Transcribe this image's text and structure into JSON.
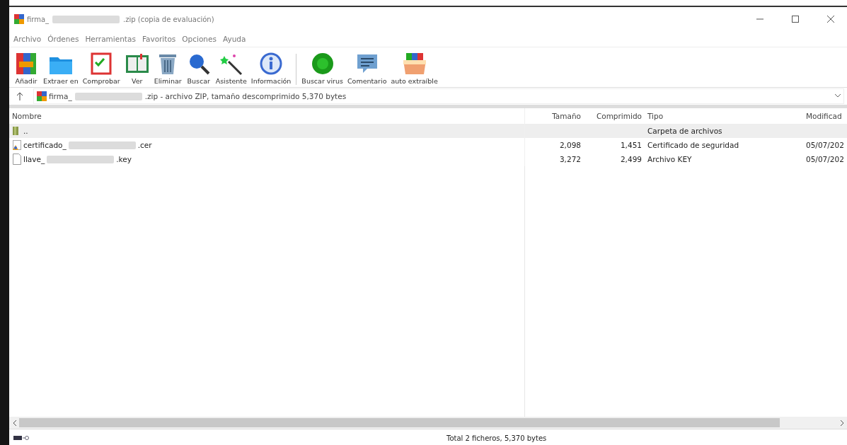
{
  "window": {
    "title_start": "firma_",
    "title_end": ".zip (copia de evaluación)"
  },
  "menu": [
    "Archivo",
    "Órdenes",
    "Herramientas",
    "Favoritos",
    "Opciones",
    "Ayuda"
  ],
  "toolbar": [
    {
      "label": "Añadir",
      "kind": "add"
    },
    {
      "label": "Extraer en",
      "kind": "extract"
    },
    {
      "label": "Comprobar",
      "kind": "test"
    },
    {
      "label": "Ver",
      "kind": "view"
    },
    {
      "label": "Eliminar",
      "kind": "delete"
    },
    {
      "label": "Buscar",
      "kind": "find"
    },
    {
      "label": "Asistente",
      "kind": "wizard"
    },
    {
      "label": "Información",
      "kind": "info"
    },
    {
      "label": "Buscar virus",
      "kind": "virus"
    },
    {
      "label": "Comentario",
      "kind": "comment"
    },
    {
      "label": "auto extraíble",
      "kind": "sfx"
    }
  ],
  "address": {
    "start": "firma_",
    "end": ".zip - archivo ZIP, tamaño descomprimido 5,370 bytes"
  },
  "table": {
    "columns": [
      "Nombre",
      "Tamaño",
      "Comprimido",
      "Tipo",
      "Modificad"
    ],
    "rows": [
      {
        "kind": "folder",
        "name_start": "..",
        "name_end": "",
        "size": "",
        "packed": "",
        "type": "Carpeta de archivos",
        "modified": "",
        "selected": true
      },
      {
        "kind": "cert",
        "name_start": "certificado_",
        "name_end": ".cer",
        "size": "2,098",
        "packed": "1,451",
        "type": "Certificado de seguridad",
        "modified": "05/07/202",
        "selected": false
      },
      {
        "kind": "file",
        "name_start": "llave_",
        "name_end": ".key",
        "size": "3,272",
        "packed": "2,499",
        "type": "Archivo KEY",
        "modified": "05/07/202",
        "selected": false
      }
    ]
  },
  "status_bar": {
    "text": "Total 2 ficheros, 5,370 bytes"
  }
}
